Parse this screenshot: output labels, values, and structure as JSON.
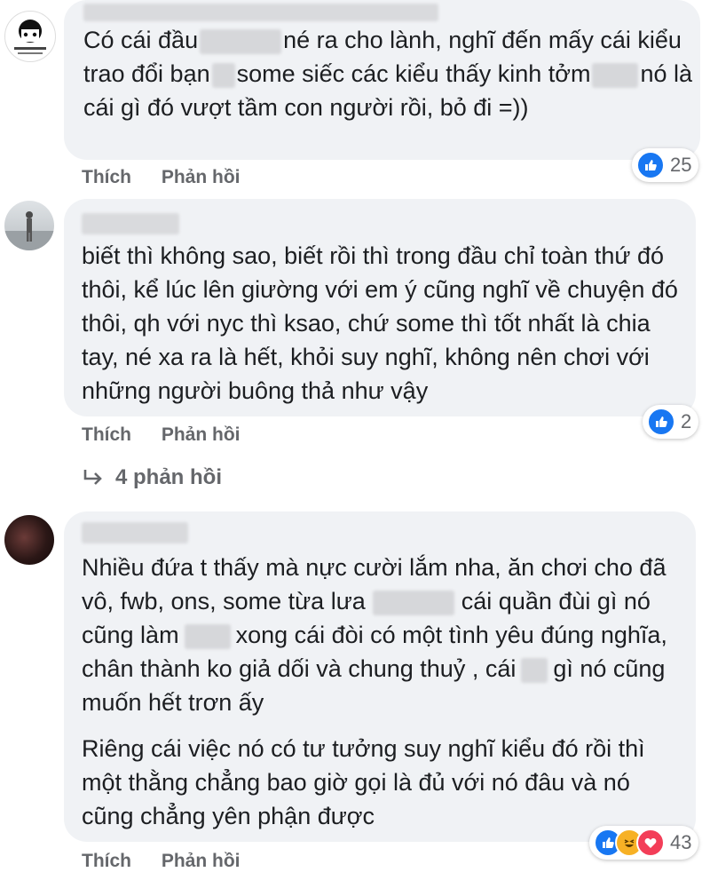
{
  "comments": [
    {
      "lines": [
        {
          "parts": [
            "Có cái đầu",
            "",
            "né ra cho lành, nghĩ đến mấy cái kiểu"
          ]
        },
        {
          "parts": [
            "trao đổi bạn",
            "",
            "some siếc các kiểu thấy kinh tởm",
            "",
            "nó là"
          ]
        },
        {
          "parts": [
            "cái gì đó vượt tầm con người rồi, bỏ đi =))"
          ]
        }
      ],
      "actions": {
        "like": "Thích",
        "reply": "Phản hồi"
      },
      "reaction_count": "25"
    },
    {
      "lines": [
        "biết thì không sao, biết rồi thì trong đầu chỉ toàn thứ đó",
        "thôi, kể lúc lên giường với em ý cũng nghĩ về chuyện đó",
        "thôi, qh với nyc thì ksao, chứ some thì tốt nhất là chia",
        "tay, né xa ra là hết, khỏi suy nghĩ, không nên chơi với",
        "những người buông thả như vậy"
      ],
      "actions": {
        "like": "Thích",
        "reply": "Phản hồi"
      },
      "reaction_count": "2",
      "replies_label": "4 phản hồi"
    },
    {
      "para1": [
        "Nhiều đứa t thấy mà nực cười lắm nha, ăn chơi cho đã",
        "vô, fwb, ons, some từa lưa",
        "cái quần đùi gì nó",
        "cũng làm",
        "xong cái đòi có một tình yêu đúng nghĩa,",
        "chân thành ko giả dối và chung thuỷ , cái",
        "gì nó cũng",
        "muốn hết trơn ấy"
      ],
      "para2": [
        "Riêng cái việc nó có tư tưởng suy nghĩ kiểu đó rồi thì",
        "một thằng chẳng bao giờ gọi là đủ với nó đâu và nó",
        "cũng chẳng yên phận được"
      ],
      "actions": {
        "like": "Thích",
        "reply": "Phản hồi"
      },
      "reaction_count": "43"
    }
  ],
  "icons": {
    "like": "like-icon",
    "haha": "haha-icon",
    "love": "love-icon",
    "reply_arrow": "reply-arrow-icon"
  },
  "colors": {
    "bubble": "#f0f2f5",
    "like_blue": "#1877f2",
    "muted_text": "#65676b"
  }
}
